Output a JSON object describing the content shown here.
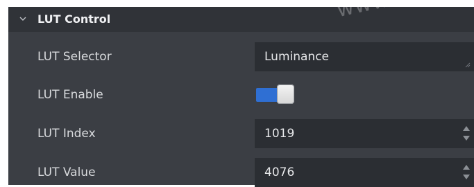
{
  "section": {
    "title": "LUT Control",
    "expanded": true
  },
  "watermark": "www.co",
  "rows": {
    "selector": {
      "label": "LUT Selector",
      "value": "Luminance"
    },
    "enable": {
      "label": "LUT Enable",
      "enabled": true
    },
    "index": {
      "label": "LUT Index",
      "value": "1019"
    },
    "value": {
      "label": "LUT Value",
      "value": "4076"
    }
  },
  "colors": {
    "panel_bg": "#3b3e44",
    "header_bg": "#303338",
    "field_bg": "#2b2e33",
    "toggle_on": "#2f6fd3",
    "text": "#d8dadd"
  },
  "icons": {
    "expand": "chevron-down-icon",
    "spin_up": "spin-up-icon",
    "spin_down": "spin-down-icon",
    "grip": "resize-grip-icon"
  }
}
